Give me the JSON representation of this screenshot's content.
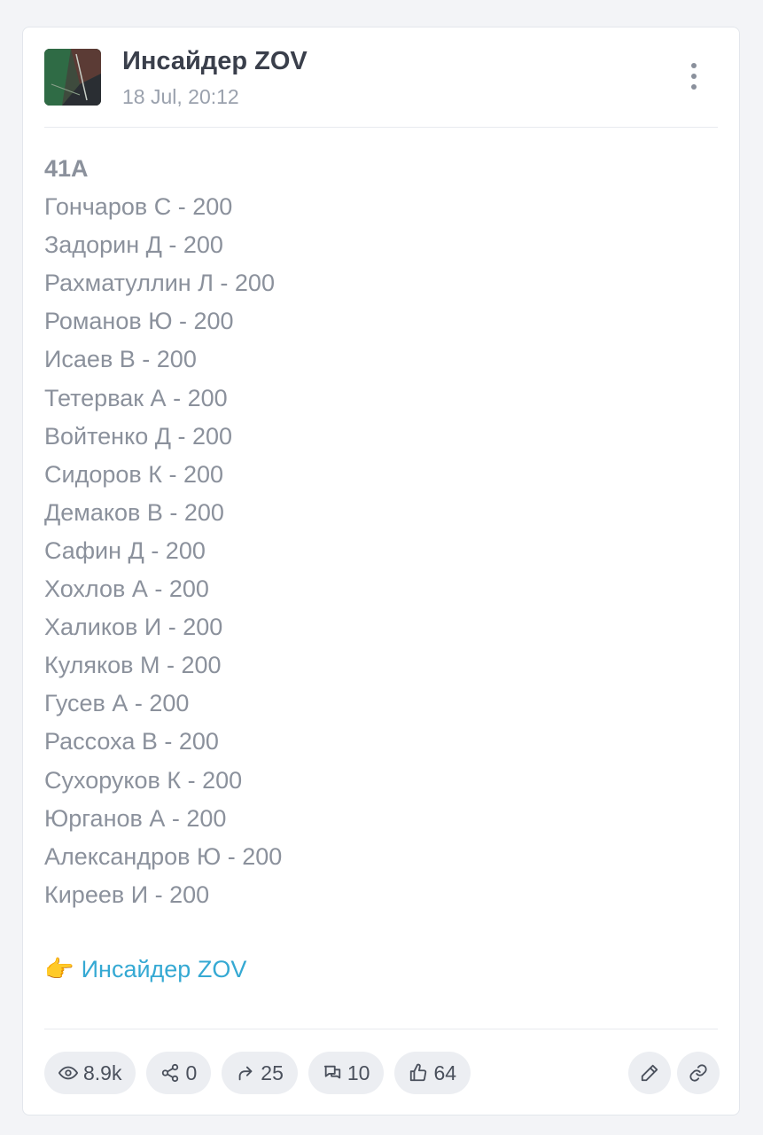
{
  "post": {
    "channel_name": "Инсайдер ZOV",
    "timestamp": "18 Jul, 20:12",
    "heading": "41A",
    "lines": [
      "Гончаров С - 200",
      "Задорин Д - 200",
      "Рахматуллин Л - 200",
      "Романов Ю - 200",
      "Исаев В - 200",
      "Тетервак А - 200",
      "Войтенко Д - 200",
      "Сидоров К - 200",
      "Демаков В - 200",
      "Сафин Д - 200",
      "Хохлов А - 200",
      "Халиков И - 200",
      "Куляков М - 200",
      "Гусев А - 200",
      "Рассоха В - 200",
      "Сухоруков К - 200",
      "Юрганов А - 200",
      "Александров Ю - 200",
      "Киреев И - 200"
    ],
    "footer_emoji": "👉",
    "footer_link_text": "Инсайдер ZOV"
  },
  "stats": {
    "views": "8.9k",
    "shares": "0",
    "forwards": "25",
    "comments": "10",
    "likes": "64"
  },
  "colors": {
    "link": "#35a9d3",
    "body_text": "#8b919c",
    "pill_bg": "#eceef2"
  }
}
